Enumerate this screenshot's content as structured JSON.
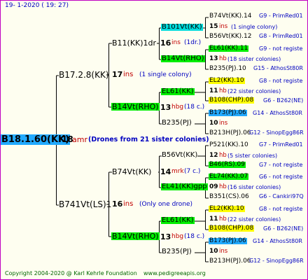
{
  "header": {
    "date": "19-   1-2020  ( 19:  27)"
  },
  "footer": {
    "copyright": "Copyright 2004-2020 @ Karl Kehrle Foundation",
    "url": "www.pedigreeapis.org"
  },
  "colors": {
    "border": "#c000c0",
    "line": "#000000",
    "ins": "#c00000",
    "blue_text": "#0000c0",
    "lime": "#00ee00",
    "cyan": "#00dddd",
    "yellow": "#ffff00",
    "blue": "#22aaff"
  },
  "root": {
    "label": "B18.1.60(KK)",
    "count": "18",
    "abbr": "amr",
    "note": "(Drones from 21 sister colonies)"
  },
  "gen1": [
    {
      "label": "B17.2.8(KK)",
      "count": "17",
      "abbr": "ins",
      "note": "(1 single colony)"
    },
    {
      "label": "B741Vt(LS)1",
      "count": "16",
      "abbr": "ins",
      "note": "(Only one drone)"
    }
  ],
  "gen2": [
    {
      "label": "B11(KK)1dr",
      "count": "16",
      "abbr": "ins",
      "note": "(1dr.)"
    },
    {
      "label": "B14Vt(RHO)",
      "count": "13",
      "abbr": "hbg",
      "note": "(18 c.)"
    },
    {
      "label": "B74Vt(KK)",
      "count": "14",
      "abbr": "mrk",
      "note": "(7 c.)"
    },
    {
      "label": "B14Vt(RHO)",
      "count": "13",
      "abbr": "hbg",
      "note": "(18 c.)"
    }
  ],
  "gen3": [
    {
      "label": "B101Vt(KK)"
    },
    {
      "label": "B14Vt(RHO)"
    },
    {
      "label": "EL61(KK)"
    },
    {
      "label": "B235(PJ)"
    },
    {
      "label": "B56Vt(KK)"
    },
    {
      "label": "EL41(KK)gpp"
    },
    {
      "label": "EL61(KK)"
    },
    {
      "label": "B235(PJ)"
    }
  ],
  "gen4": [
    {
      "label": "B74Vt(KK).14",
      "info": "G9 - PrimRed01"
    },
    {
      "label": "15",
      "abbr": "ins",
      "note": "(1 single colony)"
    },
    {
      "label": "B56Vt(KK).12",
      "info": "G8 - PrimRed01"
    },
    {
      "label": "EL61(KK).11",
      "info": "G9 - not registe"
    },
    {
      "label": "13",
      "abbr": "hb",
      "note": "(18 sister colonies)"
    },
    {
      "label": "B235(PJ).10",
      "info": "G15 - AthosSt80R"
    },
    {
      "label": "EL2(KK).10",
      "info": "G8 - not registe"
    },
    {
      "label": "11",
      "abbr": "hb",
      "note": "(22 sister colonies)"
    },
    {
      "label": "B108(CHP).08",
      "info": "G6 - B262(NE)"
    },
    {
      "label": "B173(PJ).06",
      "info": "G14 - AthosSt80R"
    },
    {
      "label": "10",
      "abbr": "ins",
      "note": ""
    },
    {
      "label": "B213H(PJ).06",
      "info": "G12 - SinopEgg86R"
    },
    {
      "label": "P521(KK).10",
      "info": "G7 - PrimRed01"
    },
    {
      "label": "12",
      "abbr": "hb",
      "note": "(5 sister colonies)"
    },
    {
      "label": "B46(RS).09",
      "info": "G7 - not registe"
    },
    {
      "label": "EL74(KK).07",
      "info": "G6 - not registe"
    },
    {
      "label": "09",
      "abbr": "hb",
      "note": "(16 sister colonies)"
    },
    {
      "label": "B351(CS).06",
      "info": "G6 - Cankiri97Q"
    },
    {
      "label": "EL2(KK).10",
      "info": "G8 - not registe"
    },
    {
      "label": "11",
      "abbr": "hb",
      "note": "(22 sister colonies)"
    },
    {
      "label": "B108(CHP).08",
      "info": "G6 - B262(NE)"
    },
    {
      "label": "B173(PJ).06",
      "info": "G14 - AthosSt80R"
    },
    {
      "label": "10",
      "abbr": "ins",
      "note": ""
    },
    {
      "label": "B213H(PJ).06",
      "info": "G12 - SinopEgg86R"
    }
  ]
}
